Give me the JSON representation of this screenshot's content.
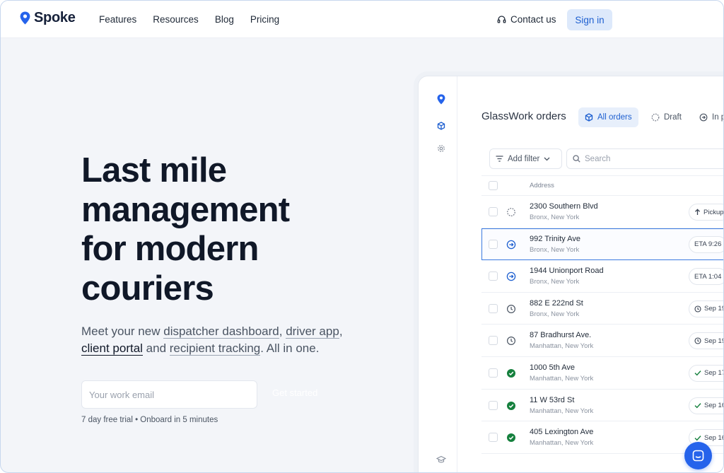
{
  "header": {
    "brand": "Spoke",
    "nav": [
      "Features",
      "Resources",
      "Blog",
      "Pricing"
    ],
    "contact_label": "Contact us",
    "signin_label": "Sign in"
  },
  "hero": {
    "title_lines": [
      "Last mile",
      "management",
      "for modern",
      "couriers"
    ],
    "sub": {
      "p1": "Meet your new ",
      "link1": "dispatcher dashboard",
      "c1": ", ",
      "link2": "driver app",
      "c2": ",",
      "link3": "client portal",
      "p2": " and ",
      "link4": "recipient tracking",
      "p3": ". All in one."
    },
    "email_placeholder": "Your work email",
    "cta": "Get started",
    "trial_note": "7 day free trial • Onboard in 5 minutes"
  },
  "app": {
    "title": "GlassWork orders",
    "tabs": [
      {
        "label": "All orders",
        "icon": "box-icon",
        "active": true
      },
      {
        "label": "Draft",
        "icon": "dashed-circle-icon",
        "active": false
      },
      {
        "label": "In p",
        "icon": "arrow-circle-icon",
        "active": false
      }
    ],
    "filter_label": "Add filter",
    "search_placeholder": "Search",
    "column_address": "Address",
    "rows": [
      {
        "address": "2300 Southern Blvd",
        "city": "Bronx, New York",
        "status": "draft",
        "tag": "Pickup"
      },
      {
        "address": "992 Trinity Ave",
        "city": "Bronx, New York",
        "status": "in-progress",
        "tag": "ETA 9:26",
        "selected": true
      },
      {
        "address": "1944 Unionport Road",
        "city": "Bronx, New York",
        "status": "in-progress",
        "tag": "ETA 1:04"
      },
      {
        "address": "882 E 222nd St",
        "city": "Bronx, New York",
        "status": "scheduled",
        "tag": "Sep 19"
      },
      {
        "address": "87 Bradhurst Ave.",
        "city": "Manhattan, New York",
        "status": "scheduled",
        "tag": "Sep 19"
      },
      {
        "address": "1000 5th Ave",
        "city": "Manhattan, New York",
        "status": "delivered",
        "tag": "Sep 17"
      },
      {
        "address": "11 W 53rd St",
        "city": "Manhattan, New York",
        "status": "delivered",
        "tag": "Sep 16"
      },
      {
        "address": "405 Lexington Ave",
        "city": "Manhattan, New York",
        "status": "delivered",
        "tag": "Sep 16"
      }
    ]
  },
  "colors": {
    "brand_blue": "#2563eb",
    "check_green": "#15803d",
    "selected_outline": "#3b7ae0"
  }
}
